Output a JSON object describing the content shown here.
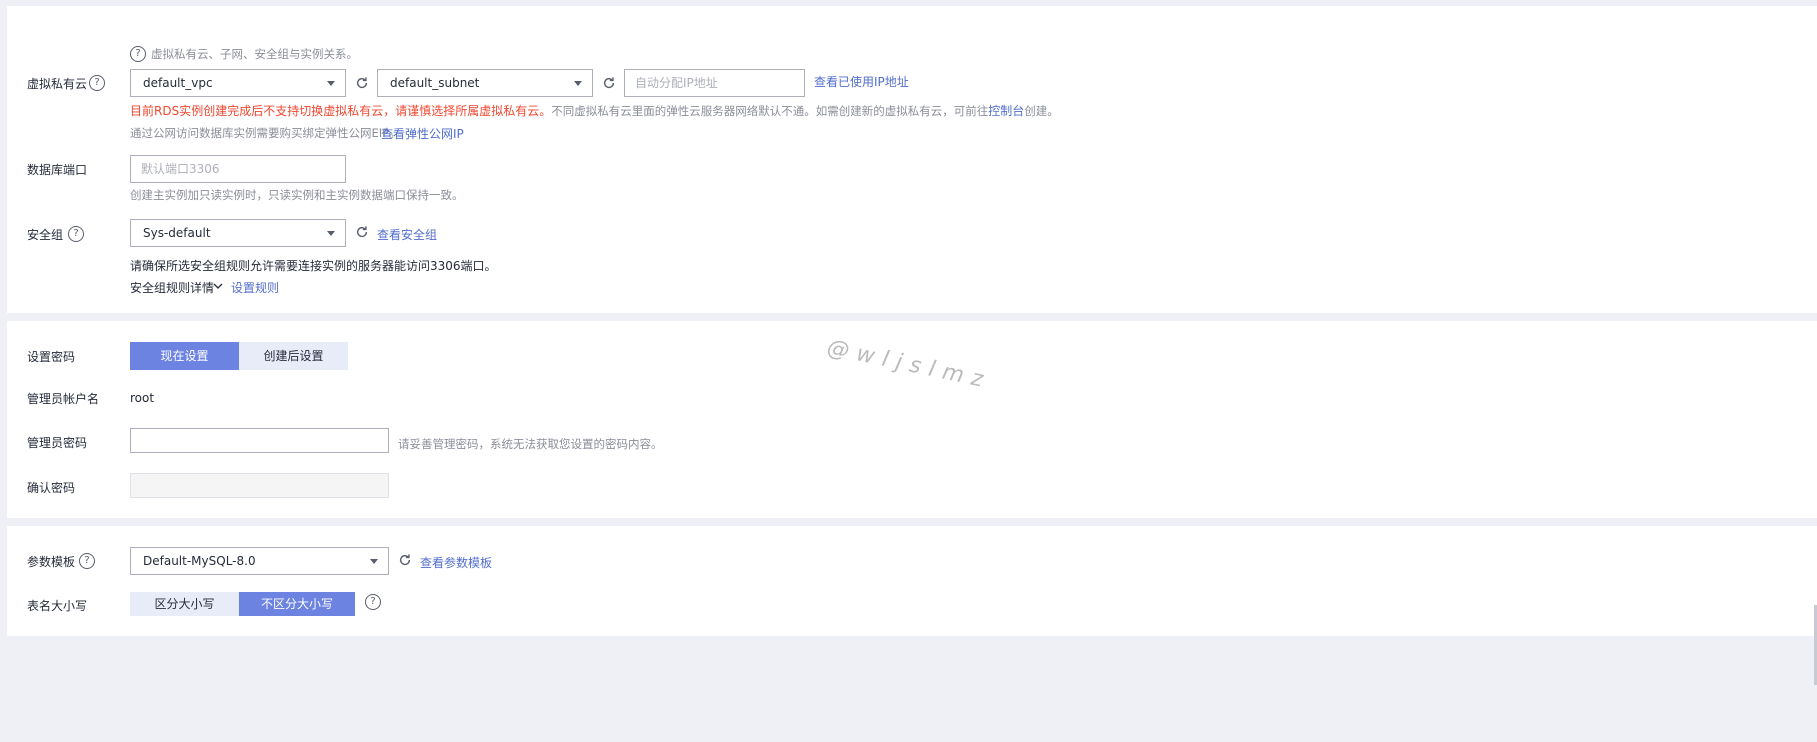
{
  "network": {
    "hint": "虚拟私有云、子网、安全组与实例关系。",
    "vpc_label": "虚拟私有云",
    "vpc_value": "default_vpc",
    "subnet_value": "default_subnet",
    "ip_placeholder": "自动分配IP地址",
    "view_ip_link": "查看已使用IP地址",
    "warning_red": "目前RDS实例创建完成后不支持切换虚拟私有云，请谨慎选择所属虚拟私有云。",
    "warning_gray_1": "不同虚拟私有云里面的弹性云服务器网络默认不通。如需创建新的虚拟私有云，可前往",
    "console_link": "控制台",
    "warning_gray_2": "创建。",
    "eip_note": "通过公网访问数据库实例需要购买绑定弹性公网EIP。",
    "view_eip_link": "查看弹性公网IP",
    "port_label": "数据库端口",
    "port_placeholder": "默认端口3306",
    "port_note": "创建主实例加只读实例时，只读实例和主实例数据端口保持一致。",
    "sg_label": "安全组",
    "sg_value": "Sys-default",
    "view_sg_link": "查看安全组",
    "sg_note": "请确保所选安全组规则允许需要连接实例的服务器能访问3306端口。",
    "sg_rules_detail": "安全组规则详情",
    "set_rules_link": "设置规则"
  },
  "password": {
    "set_label": "设置密码",
    "now_option": "现在设置",
    "later_option": "创建后设置",
    "admin_label": "管理员帐户名",
    "admin_value": "root",
    "pwd_label": "管理员密码",
    "pwd_note": "请妥善管理密码，系统无法获取您设置的密码内容。",
    "confirm_label": "确认密码"
  },
  "params": {
    "template_label": "参数模板",
    "template_value": "Default-MySQL-8.0",
    "view_template_link": "查看参数模板",
    "case_label": "表名大小写",
    "case_sensitive": "区分大小写",
    "case_insensitive": "不区分大小写"
  },
  "watermark": "@wljslmz",
  "colors": {
    "accent": "#6d83e1",
    "link": "#526ecc",
    "warning": "#f0472f"
  }
}
